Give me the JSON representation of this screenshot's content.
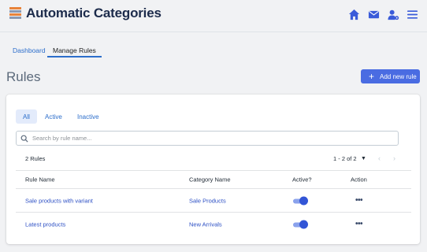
{
  "header": {
    "title": "Automatic Categories",
    "icons": [
      "app-list-icon",
      "home-icon",
      "mail-icon",
      "user-settings-icon",
      "menu-icon"
    ]
  },
  "nav": {
    "tabs": [
      {
        "label": "Dashboard",
        "active": false
      },
      {
        "label": "Manage Rules",
        "active": true
      }
    ]
  },
  "page": {
    "title": "Rules",
    "add_button_label": "Add new rule"
  },
  "filters": [
    "All",
    "Active",
    "Inactive"
  ],
  "search": {
    "placeholder": "Search by rule name..."
  },
  "summary": {
    "count": "2 Rules",
    "pagination": "1 - 2 of 2"
  },
  "table": {
    "headers": [
      "Rule Name",
      "Category Name",
      "Active?",
      "Action"
    ],
    "rows": [
      {
        "rule": "Sale products with variant",
        "category": "Sale Products",
        "active": true
      },
      {
        "rule": "Latest products",
        "category": "New Arrivals",
        "active": true
      }
    ]
  },
  "colors": {
    "accent": "#4a6ce2",
    "title": "#1c2b4b",
    "link": "#2c4fc4"
  }
}
